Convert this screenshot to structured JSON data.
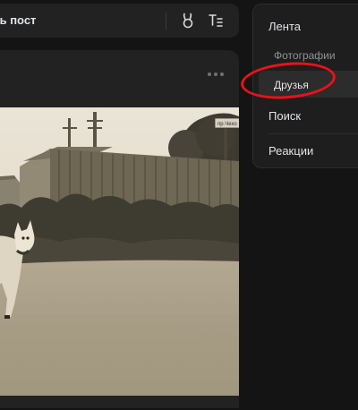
{
  "composer": {
    "placeholder_text": "ать пост",
    "icons": [
      "bunny-ears-icon",
      "text-format-icon"
    ]
  },
  "post": {
    "menu_icon": "more-horizontal-icon",
    "photo_description": "sepia-toned photo of a white dog on a dirt road beside wooden sheds",
    "photo_sign_text": "пр.Чехо"
  },
  "nav": {
    "feed": "Лента",
    "photos": "Фотографии",
    "friends": "Друзья",
    "search": "Поиск",
    "reactions": "Реакции",
    "active_item": "Друзья"
  },
  "colors": {
    "background": "#141414",
    "card": "#222222",
    "text": "#e1e3e6",
    "muted": "#8f9398",
    "annotation": "#e8121a"
  }
}
